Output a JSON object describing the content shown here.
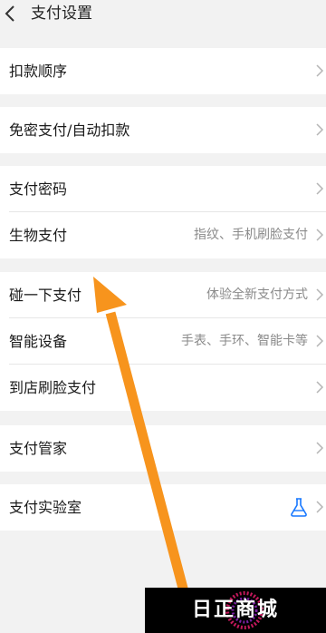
{
  "header": {
    "title": "支付设置",
    "back_icon": "chevron-left-icon"
  },
  "groups": [
    {
      "rows": [
        {
          "label": "扣款顺序",
          "sub": ""
        }
      ]
    },
    {
      "rows": [
        {
          "label": "免密支付/自动扣款",
          "sub": ""
        }
      ]
    },
    {
      "rows": [
        {
          "label": "支付密码",
          "sub": ""
        },
        {
          "label": "生物支付",
          "sub": "指纹、手机刷脸支付"
        }
      ]
    },
    {
      "rows": [
        {
          "label": "碰一下支付",
          "sub": "体验全新支付方式"
        },
        {
          "label": "智能设备",
          "sub": "手表、手环、智能卡等"
        },
        {
          "label": "到店刷脸支付",
          "sub": ""
        }
      ]
    },
    {
      "rows": [
        {
          "label": "支付管家",
          "sub": ""
        }
      ]
    },
    {
      "rows": [
        {
          "label": "支付实验室",
          "sub": "",
          "icon": "flask-icon"
        }
      ]
    }
  ],
  "overlay": {
    "arrow_color": "#f7941d",
    "watermark_text": "日正商城"
  },
  "colors": {
    "background": "#f2f2f2",
    "accent_icon": "#1677ff"
  }
}
